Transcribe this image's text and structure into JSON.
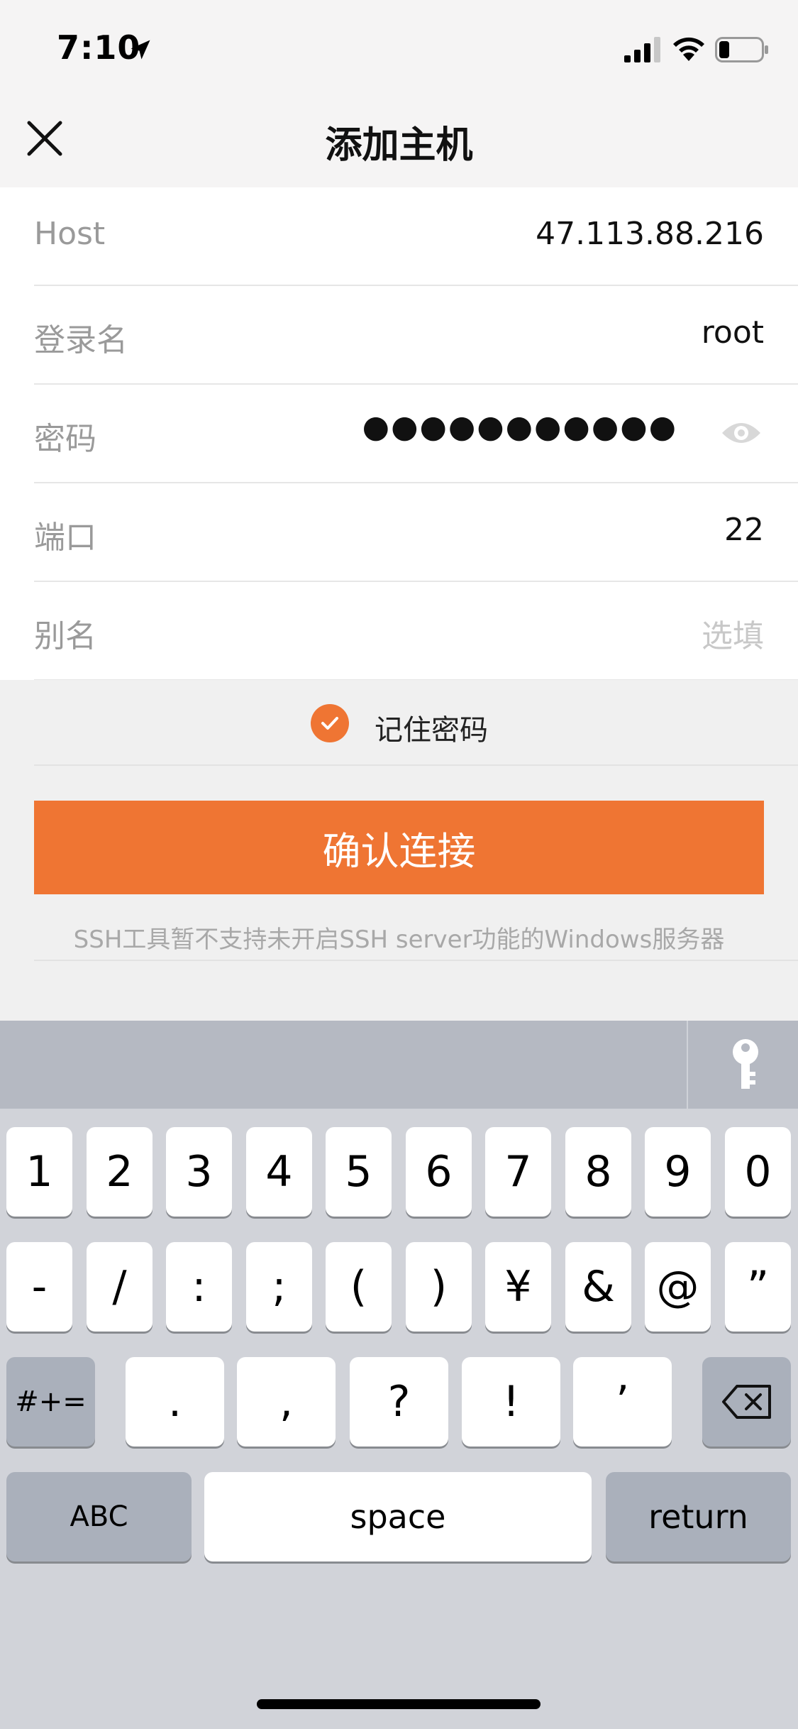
{
  "status_bar": {
    "time": "7:10"
  },
  "nav": {
    "title": "添加主机"
  },
  "form": {
    "host": {
      "label": "Host",
      "value": "47.113.88.216"
    },
    "username": {
      "label": "登录名",
      "value": "root"
    },
    "password": {
      "label": "密码",
      "masked": "●●●●●●●●●●●"
    },
    "port": {
      "label": "端口",
      "value": "22"
    },
    "alias": {
      "label": "别名",
      "placeholder": "选填"
    }
  },
  "remember": {
    "label": "记住密码",
    "checked": true
  },
  "connect_button": {
    "label": "确认连接"
  },
  "notice": "SSH工具暂不支持未开启SSH server功能的Windows服务器",
  "colors": {
    "accent": "#ef7533"
  },
  "keyboard": {
    "row1": [
      "1",
      "2",
      "3",
      "4",
      "5",
      "6",
      "7",
      "8",
      "9",
      "0"
    ],
    "row2": [
      "-",
      "/",
      ":",
      ";",
      "(",
      ")",
      "¥",
      "&",
      "@",
      "”"
    ],
    "row3_left": "#+=",
    "row3": [
      ".",
      ",",
      "?",
      "!",
      "’"
    ],
    "abc": "ABC",
    "space": "space",
    "return": "return"
  }
}
